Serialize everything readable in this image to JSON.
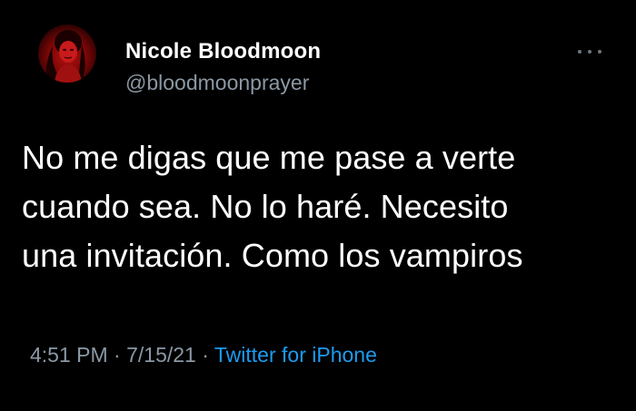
{
  "tweet": {
    "author": {
      "display_name": "Nicole Bloodmoon",
      "handle": "@bloodmoonprayer",
      "avatar": "profile-photo"
    },
    "more_icon": "ellipsis-icon",
    "text_lines": [
      "No me digas que me pase a verte",
      "cuando sea. No lo haré. Necesito",
      "una invitación. Como los vampiros"
    ],
    "time": "4:51 PM",
    "date": "7/15/21",
    "separator": "·",
    "source": "Twitter for iPhone"
  },
  "colors": {
    "background": "#000000",
    "primary_text": "#ffffff",
    "secondary_text": "#8b98a5",
    "link": "#1d9bf0",
    "avatar_accent": "#b21010"
  }
}
